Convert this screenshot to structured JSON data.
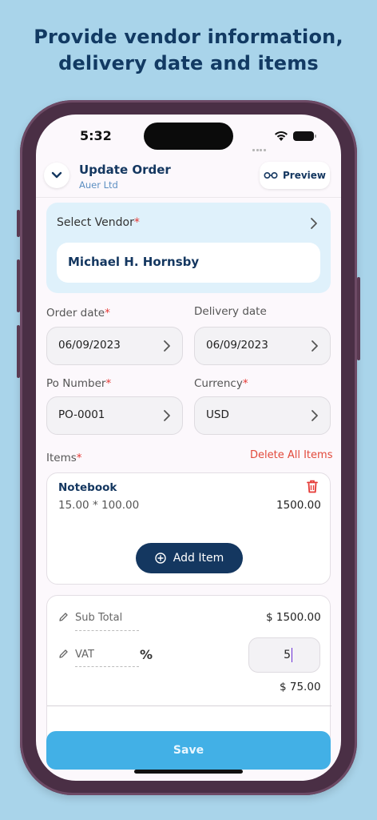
{
  "headline": {
    "line1": "Provide vendor information,",
    "line2": "delivery date and items"
  },
  "status_bar": {
    "time": "5:32"
  },
  "header": {
    "title": "Update Order",
    "subtitle": "Auer Ltd",
    "preview_label": "Preview"
  },
  "vendor": {
    "label": "Select Vendor",
    "required_mark": "*",
    "value": "Michael H. Hornsby"
  },
  "fields": {
    "order_date": {
      "label": "Order date",
      "required_mark": "*",
      "value": "06/09/2023"
    },
    "delivery_date": {
      "label": "Delivery date",
      "value": "06/09/2023"
    },
    "po_number": {
      "label": "Po Number",
      "required_mark": "*",
      "value": "PO-0001"
    },
    "currency": {
      "label": "Currency",
      "required_mark": "*",
      "value": "USD"
    }
  },
  "items": {
    "label": "Items",
    "required_mark": "*",
    "delete_all_label": "Delete All Items",
    "list": [
      {
        "name": "Notebook",
        "calc": "15.00 * 100.00",
        "total": "1500.00"
      }
    ],
    "add_item_label": "Add Item"
  },
  "totals": {
    "subtotal_label": "Sub Total",
    "subtotal_value": "$ 1500.00",
    "vat_label": "VAT",
    "vat_percent_symbol": "%",
    "vat_input_value": "5",
    "vat_amount": "$ 75.00"
  },
  "save_label": "Save",
  "colors": {
    "background": "#a9d4ea",
    "navy": "#143760",
    "accent_blue": "#42b0e6",
    "danger": "#e24a3b"
  }
}
